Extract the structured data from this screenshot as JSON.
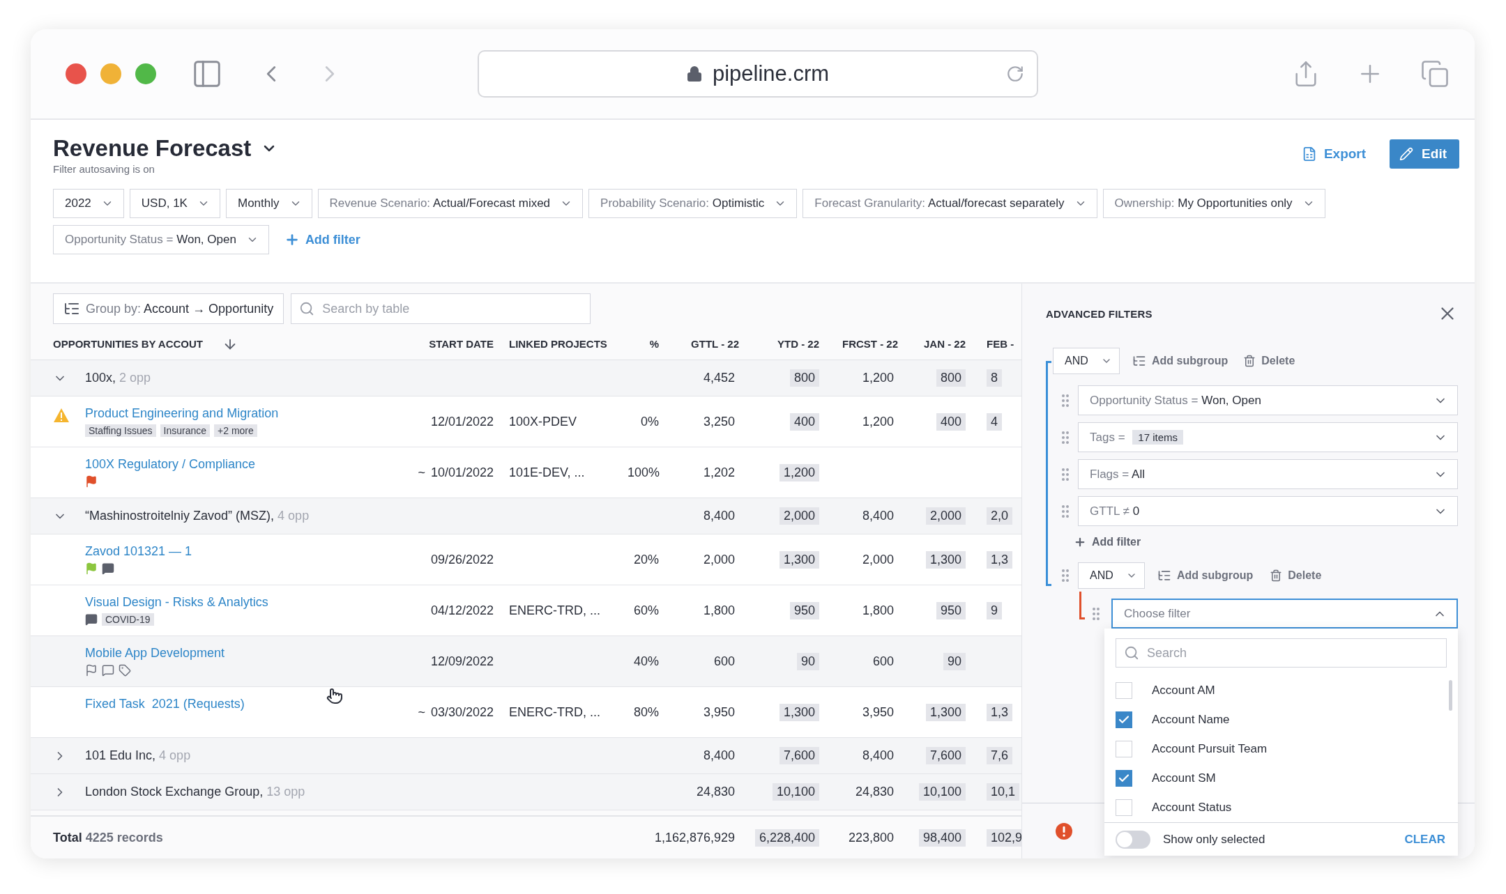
{
  "browser": {
    "url": "pipeline.crm"
  },
  "page": {
    "title": "Revenue Forecast",
    "subtitle": "Filter autosaving is on",
    "actions": [
      {
        "kind": "export",
        "label": "Export"
      },
      {
        "kind": "edit",
        "label": "Edit"
      }
    ]
  },
  "filters": [
    {
      "value": "2022"
    },
    {
      "value": "USD, 1K"
    },
    {
      "value": "Monthly"
    },
    {
      "label": "Revenue Scenario:",
      "value": "Actual/Forecast mixed"
    },
    {
      "label": "Probability Scenario:",
      "value": "Optimistic"
    },
    {
      "label": "Forecast Granularity:",
      "value": "Actual/forecast separately"
    },
    {
      "label": "Ownership:",
      "value": "My Opportunities only"
    },
    {
      "label": "Opportunity Status =",
      "value": "Won, Open"
    }
  ],
  "add_filter": "Add filter",
  "toolbar": {
    "group_by_label": "Group by:",
    "group_by_value": "Account → Opportunity",
    "search_placeholder": "Search by table"
  },
  "table": {
    "columns": [
      {
        "label": "OPPORTUNITIES BY ACCOUT",
        "sorted": true
      },
      {
        "label": "START DATE",
        "sorted": false
      },
      {
        "label": "LINKED PROJECTS",
        "sorted": false
      },
      {
        "label": "%",
        "sorted": false
      },
      {
        "label": "GTTL - 22",
        "sorted": false
      },
      {
        "label": "YTD - 22",
        "sorted": false
      },
      {
        "label": "FRCST - 22",
        "sorted": false
      },
      {
        "label": "JAN - 22",
        "sorted": false
      },
      {
        "label": "FEB -",
        "sorted": false
      }
    ],
    "groups": [
      {
        "name": "100x,",
        "count": "2 opp",
        "expanded": true,
        "values": [
          {
            "text": "4,452",
            "shaded": false
          },
          {
            "text": "800",
            "shaded": true
          },
          {
            "text": "1,200",
            "shaded": false
          },
          {
            "text": "800",
            "shaded": true
          },
          {
            "text": "8",
            "shaded": true
          }
        ],
        "children": [
          {
            "name": "Product Engineering and Migration",
            "warning": true,
            "hovered": false,
            "tags": [
              "Staffing Issues",
              "Insurance",
              "+2 more"
            ],
            "start_date": "12/01/2022",
            "linked_projects": "100X-PDEV",
            "percent": "0%",
            "values": [
              {
                "text": "3,250",
                "shaded": false
              },
              {
                "text": "400",
                "shaded": true
              },
              {
                "text": "1,200",
                "shaded": false
              },
              {
                "text": "400",
                "shaded": true
              },
              {
                "text": "4",
                "shaded": true
              }
            ]
          },
          {
            "name": "100X Regulatory / Compliance",
            "warning": false,
            "hovered": false,
            "markers": [
              {
                "kind": "flag",
                "color": "#e0502b"
              }
            ],
            "date_prefix": "~",
            "start_date": "10/01/2022",
            "linked_projects": "101E-DEV, ...",
            "percent": "100%",
            "values": [
              {
                "text": "1,202",
                "shaded": false
              },
              {
                "text": "1,200",
                "shaded": true
              }
            ]
          }
        ]
      },
      {
        "name": "“Mashinostroitelniy Zavod” (MSZ),",
        "count": "4 opp",
        "expanded": true,
        "values": [
          {
            "text": "8,400",
            "shaded": false
          },
          {
            "text": "2,000",
            "shaded": true
          },
          {
            "text": "8,400",
            "shaded": false
          },
          {
            "text": "2,000",
            "shaded": true
          },
          {
            "text": "2,0",
            "shaded": true
          }
        ],
        "children": [
          {
            "name": "Zavod 101321 — 1",
            "warning": false,
            "hovered": false,
            "markers": [
              {
                "kind": "flag",
                "color": "#8cc63f"
              },
              {
                "kind": "comment"
              }
            ],
            "start_date": "09/26/2022",
            "percent": "20%",
            "values": [
              {
                "text": "2,000",
                "shaded": false
              },
              {
                "text": "1,300",
                "shaded": true
              },
              {
                "text": "2,000",
                "shaded": false
              },
              {
                "text": "1,300",
                "shaded": true
              },
              {
                "text": "1,3",
                "shaded": true
              }
            ]
          },
          {
            "name": "Visual Design - Risks & Analytics",
            "warning": false,
            "hovered": false,
            "markers": [
              {
                "kind": "comment"
              }
            ],
            "tags": [
              "COVID-19"
            ],
            "start_date": "04/12/2022",
            "linked_projects": "ENERC-TRD, ...",
            "percent": "60%",
            "values": [
              {
                "text": "1,800",
                "shaded": false
              },
              {
                "text": "950",
                "shaded": true
              },
              {
                "text": "1,800",
                "shaded": false
              },
              {
                "text": "950",
                "shaded": true
              },
              {
                "text": "9",
                "shaded": true
              }
            ]
          },
          {
            "name": "Mobile App Development",
            "warning": false,
            "hovered": true,
            "markers": [
              {
                "kind": "flag-outline"
              },
              {
                "kind": "comment-outline"
              },
              {
                "kind": "tag-outline"
              }
            ],
            "start_date": "12/09/2022",
            "percent": "40%",
            "values": [
              {
                "text": "600",
                "shaded": false
              },
              {
                "text": "90",
                "shaded": true
              },
              {
                "text": "600",
                "shaded": false
              },
              {
                "text": "90",
                "shaded": true
              }
            ]
          },
          {
            "name": "Fixed Task  2021 (Requests)",
            "warning": false,
            "hovered": false,
            "date_prefix": "~",
            "start_date": "03/30/2022",
            "linked_projects": "ENERC-TRD, ...",
            "percent": "80%",
            "values": [
              {
                "text": "3,950",
                "shaded": false
              },
              {
                "text": "1,300",
                "shaded": true
              },
              {
                "text": "3,950",
                "shaded": false
              },
              {
                "text": "1,300",
                "shaded": true
              },
              {
                "text": "1,3",
                "shaded": true
              }
            ]
          }
        ]
      },
      {
        "name": "101 Edu Inc,",
        "count": "4 opp",
        "expanded": false,
        "values": [
          {
            "text": "8,400",
            "shaded": false
          },
          {
            "text": "7,600",
            "shaded": true
          },
          {
            "text": "8,400",
            "shaded": false
          },
          {
            "text": "7,600",
            "shaded": true
          },
          {
            "text": "7,6",
            "shaded": true
          }
        ]
      },
      {
        "name": "London Stock Exchange Group,",
        "count": "13 opp",
        "expanded": false,
        "values": [
          {
            "text": "24,830",
            "shaded": false
          },
          {
            "text": "10,100",
            "shaded": true
          },
          {
            "text": "24,830",
            "shaded": false
          },
          {
            "text": "10,100",
            "shaded": true
          },
          {
            "text": "10,1",
            "shaded": true
          }
        ]
      }
    ],
    "footer": {
      "label": "Total",
      "count": "4225 records",
      "values": [
        {
          "text": "1,162,876,929",
          "shaded": false
        },
        {
          "text": "6,228,400",
          "shaded": true
        },
        {
          "text": "223,800",
          "shaded": false
        },
        {
          "text": "98,400",
          "shaded": true
        },
        {
          "text": "102,9",
          "shaded": true
        }
      ]
    }
  },
  "panel": {
    "title": "ADVANCED FILTERS",
    "alert": true,
    "group": {
      "operator": "AND",
      "add_subgroup": "Add subgroup",
      "delete": "Delete",
      "conditions": [
        {
          "field": "Opportunity Status",
          "operator": "=",
          "value": "Won, Open"
        },
        {
          "field": "Tags",
          "operator": "=",
          "chip": "17 items"
        },
        {
          "field": "Flags",
          "operator": "=",
          "value": "All"
        },
        {
          "field": "GTTL",
          "operator": "≠",
          "value": "0"
        }
      ],
      "add_filter": "Add filter",
      "subgroup": {
        "operator": "AND",
        "add_subgroup": "Add subgroup",
        "delete": "Delete",
        "picker": {
          "placeholder": "Choose filter",
          "expanded": true,
          "search_placeholder": "Search",
          "options": [
            {
              "label": "Account AM",
              "checked": false
            },
            {
              "label": "Account Name",
              "checked": true
            },
            {
              "label": "Account Pursuit Team",
              "checked": false
            },
            {
              "label": "Account SM",
              "checked": true
            },
            {
              "label": "Account Status",
              "checked": false
            }
          ],
          "show_only_selected": {
            "label": "Show only selected",
            "on": false
          },
          "clear": "CLEAR"
        }
      }
    }
  }
}
